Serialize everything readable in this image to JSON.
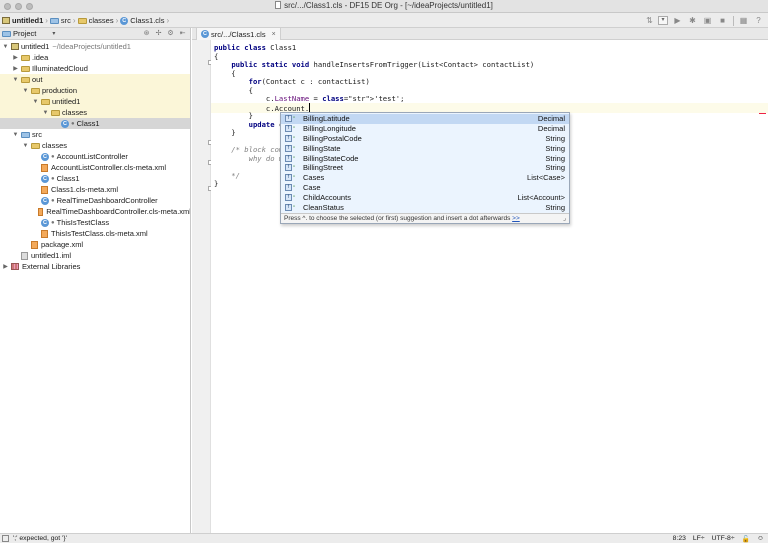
{
  "window": {
    "title": "src/.../Class1.cls - DF15 DE Org - [~/ideaProjects/untitled1]"
  },
  "breadcrumb": [
    "untitled1",
    "src",
    "classes",
    "Class1.cls"
  ],
  "project_panel": {
    "selector": "Project",
    "tree": [
      {
        "indent": 0,
        "arrow": "▼",
        "icon": "module",
        "label": "untitled1",
        "extra": "~/IdeaProjects/untitled1",
        "bg": ""
      },
      {
        "indent": 1,
        "arrow": "▶",
        "icon": "folder",
        "label": ".idea",
        "bg": ""
      },
      {
        "indent": 1,
        "arrow": "▶",
        "icon": "folder",
        "label": "IlluminatedCloud",
        "bg": ""
      },
      {
        "indent": 1,
        "arrow": "▼",
        "icon": "folder",
        "label": "out",
        "bg": "yellow"
      },
      {
        "indent": 2,
        "arrow": "▼",
        "icon": "folder",
        "label": "production",
        "bg": "yellow"
      },
      {
        "indent": 3,
        "arrow": "▼",
        "icon": "folder",
        "label": "untitled1",
        "bg": "yellow"
      },
      {
        "indent": 4,
        "arrow": "▼",
        "icon": "folder",
        "label": "classes",
        "bg": "yellow"
      },
      {
        "indent": 5,
        "arrow": "",
        "icon": "class",
        "label": "Class1",
        "bg": "sel"
      },
      {
        "indent": 1,
        "arrow": "▼",
        "icon": "folder-blue",
        "label": "src",
        "bg": ""
      },
      {
        "indent": 2,
        "arrow": "▼",
        "icon": "folder",
        "label": "classes",
        "bg": ""
      },
      {
        "indent": 3,
        "arrow": "",
        "icon": "class",
        "label": "AccountListController",
        "bg": ""
      },
      {
        "indent": 3,
        "arrow": "",
        "icon": "file",
        "label": "AccountListController.cls-meta.xml",
        "bg": ""
      },
      {
        "indent": 3,
        "arrow": "",
        "icon": "class",
        "label": "Class1",
        "bg": ""
      },
      {
        "indent": 3,
        "arrow": "",
        "icon": "file",
        "label": "Class1.cls-meta.xml",
        "bg": ""
      },
      {
        "indent": 3,
        "arrow": "",
        "icon": "class",
        "label": "RealTimeDashboardController",
        "bg": ""
      },
      {
        "indent": 3,
        "arrow": "",
        "icon": "file",
        "label": "RealTimeDashboardController.cls-meta.xml",
        "bg": ""
      },
      {
        "indent": 3,
        "arrow": "",
        "icon": "class",
        "label": "ThisIsTestClass",
        "bg": ""
      },
      {
        "indent": 3,
        "arrow": "",
        "icon": "file",
        "label": "ThisIsTestClass.cls-meta.xml",
        "bg": ""
      },
      {
        "indent": 2,
        "arrow": "",
        "icon": "file",
        "label": "package.xml",
        "bg": ""
      },
      {
        "indent": 1,
        "arrow": "",
        "icon": "iml",
        "label": "untitled1.iml",
        "bg": ""
      },
      {
        "indent": 0,
        "arrow": "▶",
        "icon": "library",
        "label": "External Libraries",
        "bg": ""
      }
    ]
  },
  "editor": {
    "tab_label": "src/.../Class1.cls",
    "lines": [
      {
        "t": "public class Class1",
        "k": "kw-first2"
      },
      {
        "t": "{"
      },
      {
        "t": "    public static void handleInsertsFromTrigger(List<Contact> contactList)"
      },
      {
        "t": "    {"
      },
      {
        "t": "        for(Contact c : contactList)"
      },
      {
        "t": "        {"
      },
      {
        "t": "            c.LastName = 'test';"
      },
      {
        "t": "            c.Account."
      },
      {
        "t": "        }"
      },
      {
        "t": "        update co"
      },
      {
        "t": "    }"
      },
      {
        "t": ""
      },
      {
        "t": "    /* block comm"
      },
      {
        "t": "        why do we"
      },
      {
        "t": ""
      },
      {
        "t": "    */"
      },
      {
        "t": "}"
      }
    ]
  },
  "completion": {
    "items": [
      {
        "name": "BillingLatitude",
        "type": "Decimal"
      },
      {
        "name": "BillingLongitude",
        "type": "Decimal"
      },
      {
        "name": "BillingPostalCode",
        "type": "String"
      },
      {
        "name": "BillingState",
        "type": "String"
      },
      {
        "name": "BillingStateCode",
        "type": "String"
      },
      {
        "name": "BillingStreet",
        "type": "String"
      },
      {
        "name": "Cases",
        "type": "List<Case>"
      },
      {
        "name": "Case",
        "type": ""
      },
      {
        "name": "ChildAccounts",
        "type": "List<Account>"
      },
      {
        "name": "CleanStatus",
        "type": "String"
      },
      {
        "name": "CombinedAttachments",
        "type": "List<CombinedAttachment>"
      }
    ],
    "footer_text": "Press ^. to choose the selected (or first) suggestion and insert a dot afterwards",
    "footer_link": ">>"
  },
  "status": {
    "message": "';' expected, got '}'",
    "position": "8:23",
    "line_sep": "LF÷",
    "encoding": "UTF-8÷"
  }
}
